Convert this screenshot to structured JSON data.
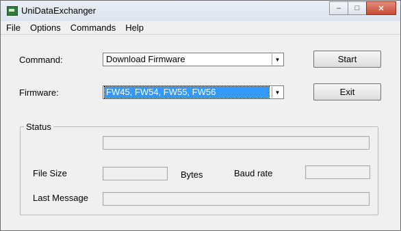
{
  "window": {
    "title": "UniDataExchanger",
    "app_icon": "app-icon"
  },
  "controls": {
    "minimize": "–",
    "maximize": "□",
    "close": "✕"
  },
  "menu": [
    {
      "label": "File"
    },
    {
      "label": "Options"
    },
    {
      "label": "Commands"
    },
    {
      "label": "Help"
    }
  ],
  "command": {
    "label": "Command:",
    "value": "Download Firmware"
  },
  "firmware": {
    "label": "Firmware:",
    "value": "FW45, FW54, FW55, FW56"
  },
  "buttons": {
    "start": "Start",
    "exit": "Exit"
  },
  "status": {
    "title": "Status",
    "file_size_label": "File Size",
    "bytes_label": "Bytes",
    "baud_rate_label": "Baud rate",
    "last_message_label": "Last Message",
    "progress_value": "",
    "file_size_value": "",
    "baud_rate_value": "",
    "last_message_value": ""
  }
}
